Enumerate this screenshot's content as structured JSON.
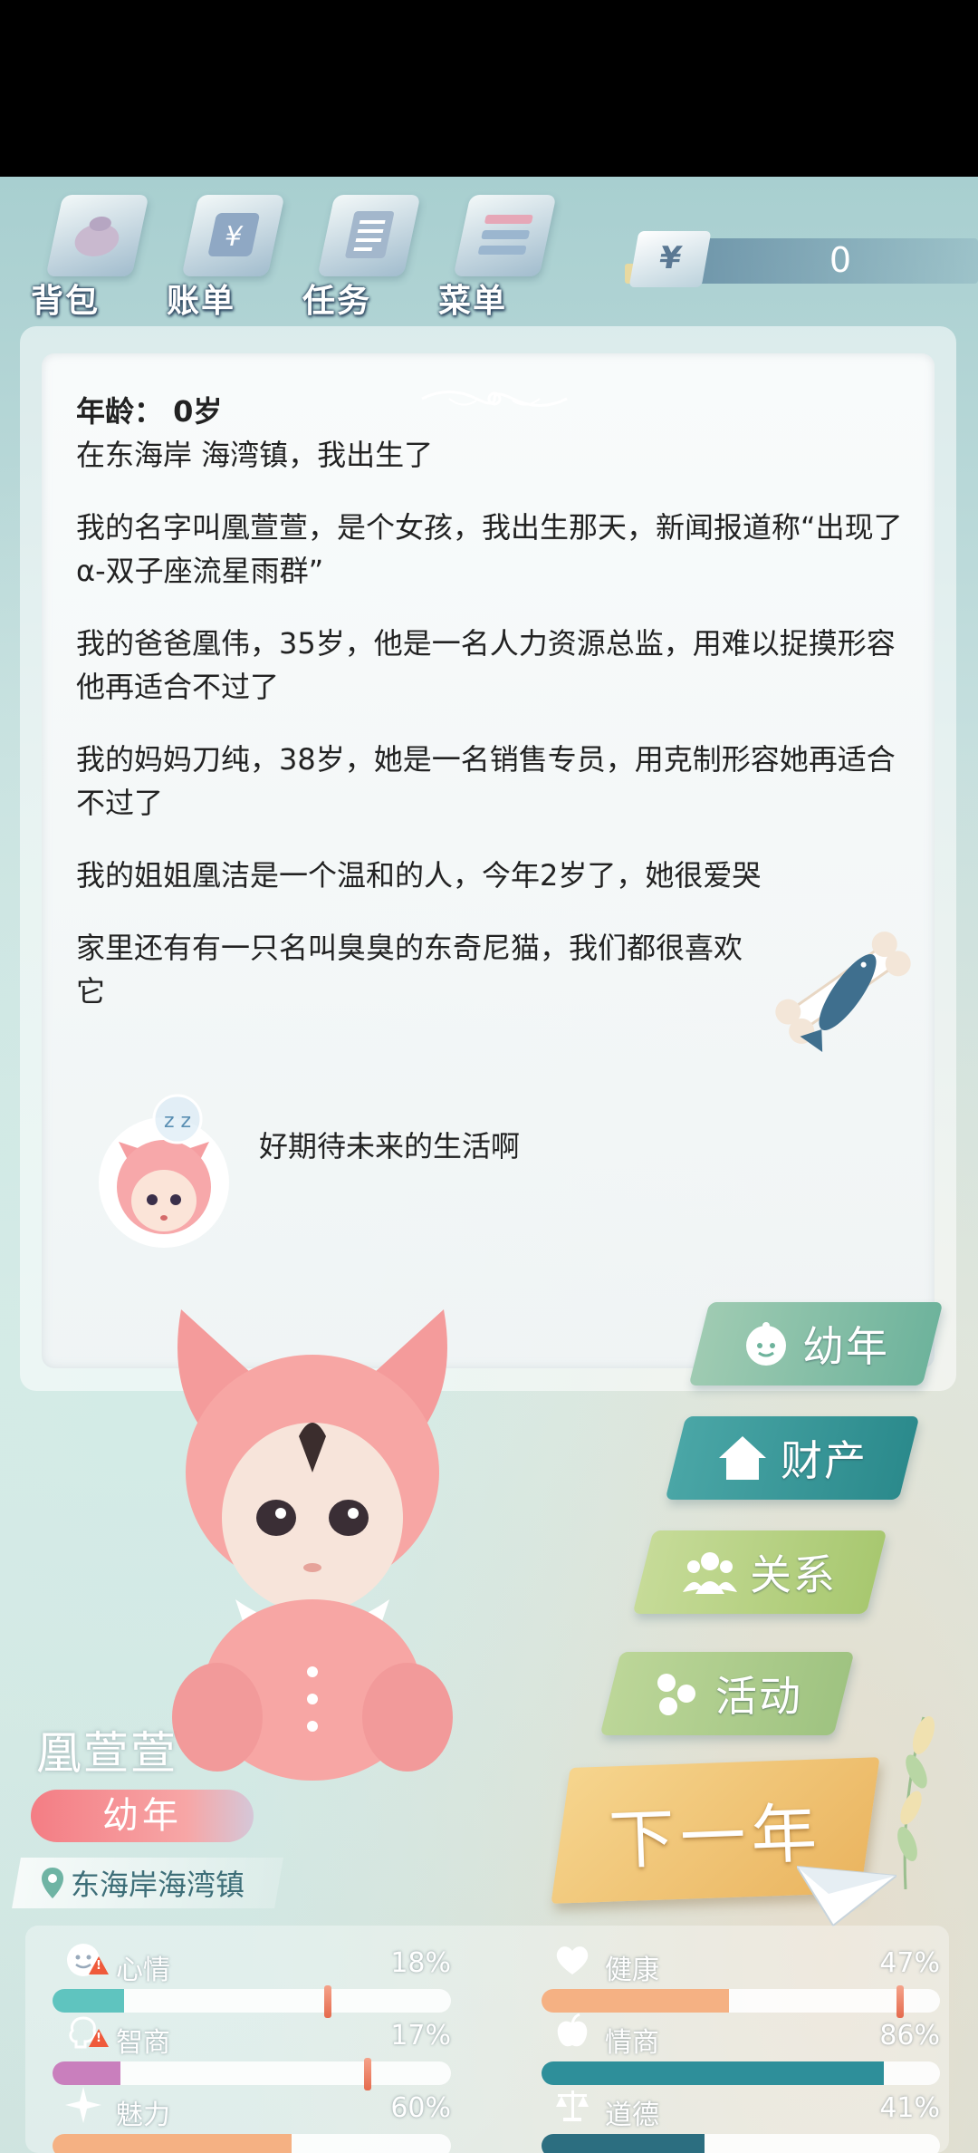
{
  "toolbar": {
    "items": [
      {
        "label": "背包",
        "icon": "bag-icon"
      },
      {
        "label": "账单",
        "icon": "bill-icon"
      },
      {
        "label": "任务",
        "icon": "task-icon"
      },
      {
        "label": "菜单",
        "icon": "menu-icon"
      }
    ],
    "money": {
      "symbol": "¥",
      "amount": "0"
    }
  },
  "story": {
    "age_line": "年龄： 0岁",
    "paragraphs": [
      "在东海岸 海湾镇，我出生了",
      "我的名字叫凰萱萱，是个女孩，我出生那天，新闻报道称“出现了α-双子座流星雨群”",
      "我的爸爸凰伟，35岁，他是一名人力资源总监，用难以捉摸形容他再适合不过了",
      "我的妈妈刀纯，38岁，她是一名销售专员，用克制形容她再适合不过了",
      "我的姐姐凰洁是一个温和的人，今年2岁了，她很爱哭",
      "家里还有有一只名叫臭臭的东奇尼猫，我们都很喜欢它"
    ],
    "bubble": "好期待未来的生活啊"
  },
  "side_buttons": {
    "youth": "幼年",
    "assets": "财产",
    "relations": "关系",
    "activities": "活动"
  },
  "next_year": "下一年",
  "character": {
    "name": "凰萱萱",
    "stage": "幼年",
    "location": "东海岸海湾镇"
  },
  "stats": [
    {
      "name": "心情",
      "pct": "18%",
      "value": 0.18,
      "marker": 0.69,
      "color": "#5fc4bf",
      "icon": "smile-icon",
      "warning": true
    },
    {
      "name": "健康",
      "pct": "47%",
      "value": 0.47,
      "marker": 0.9,
      "color": "#f5b183",
      "icon": "heart-icon",
      "warning": false
    },
    {
      "name": "智商",
      "pct": "17%",
      "value": 0.17,
      "marker": 0.79,
      "color": "#c97fbd",
      "icon": "brain-icon",
      "warning": true
    },
    {
      "name": "情商",
      "pct": "86%",
      "value": 0.86,
      "marker": null,
      "color": "#2e8f9a",
      "icon": "apple-icon",
      "warning": false
    },
    {
      "name": "魅力",
      "pct": "60%",
      "value": 0.6,
      "marker": null,
      "color": "#f5b183",
      "icon": "sparkle-icon",
      "warning": false
    },
    {
      "name": "道德",
      "pct": "41%",
      "value": 0.41,
      "marker": null,
      "color": "#2c6e80",
      "icon": "scale-icon",
      "warning": false
    }
  ]
}
